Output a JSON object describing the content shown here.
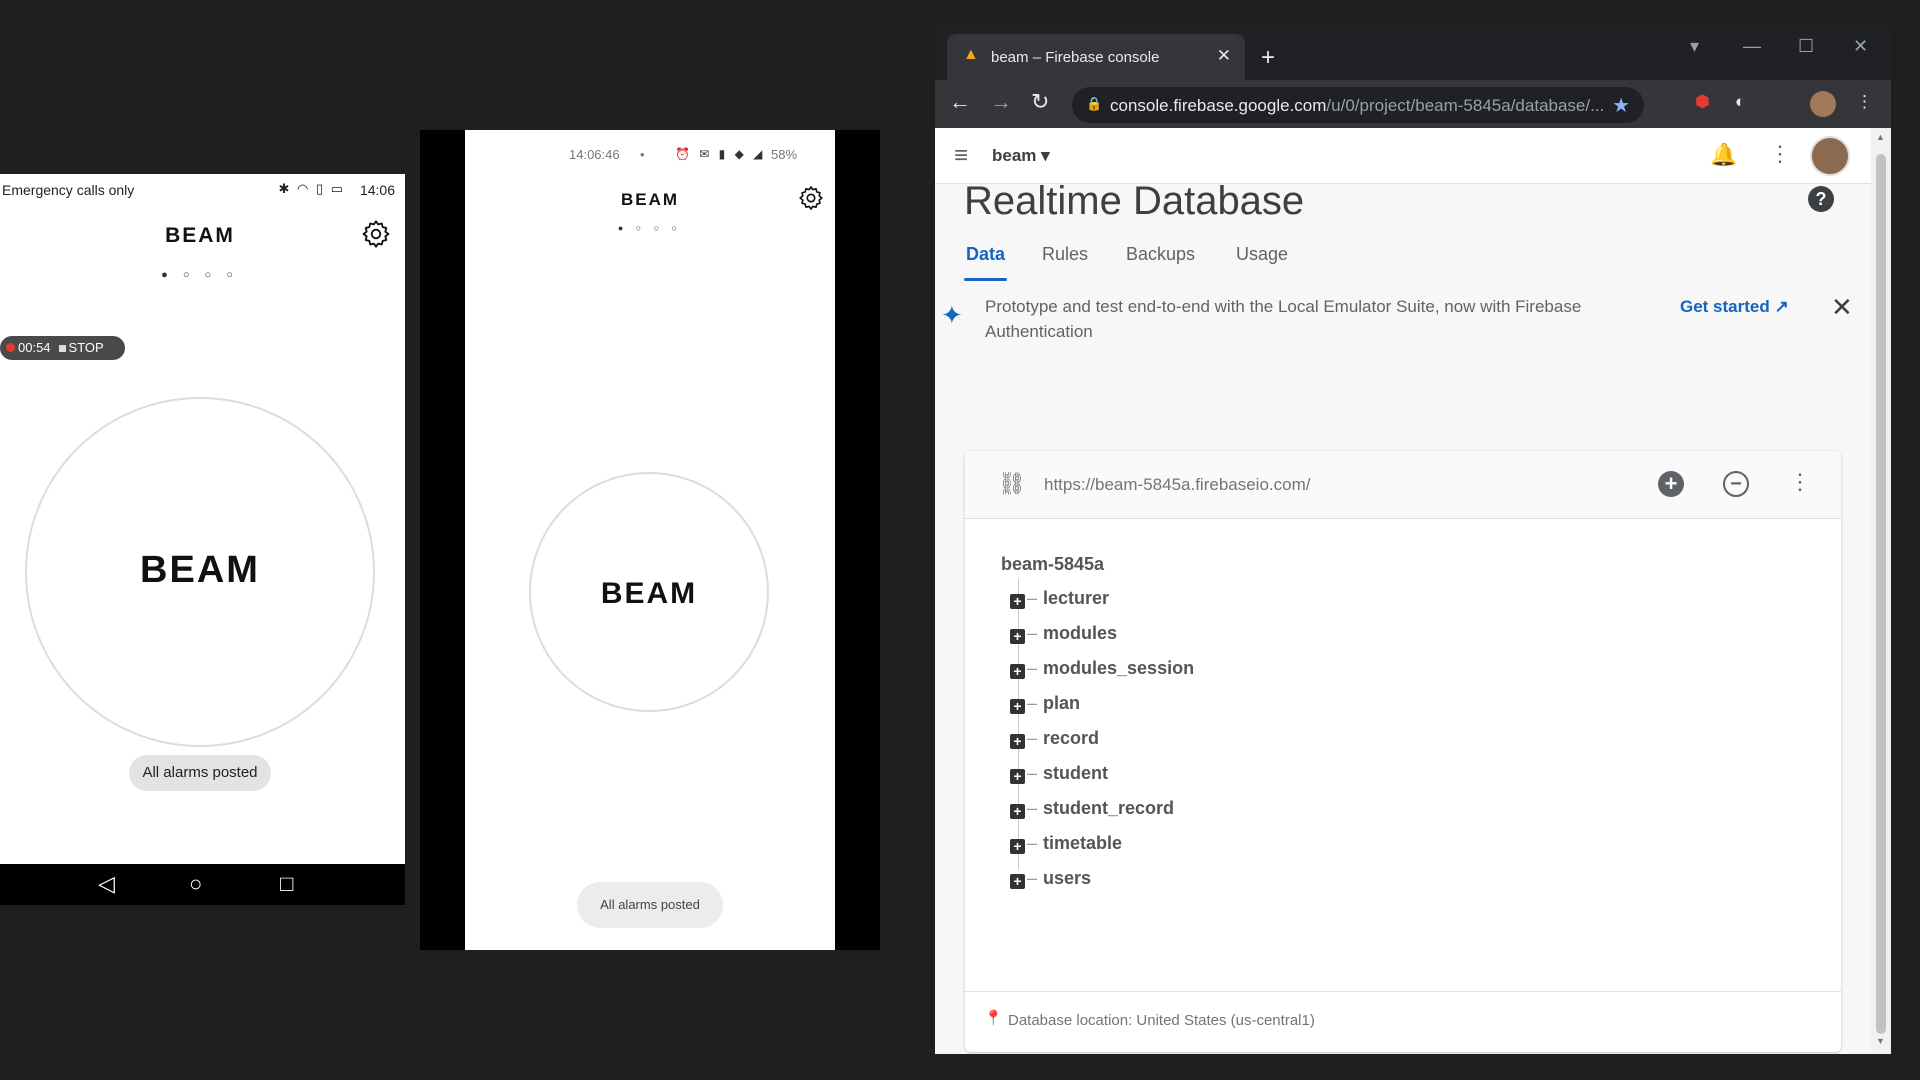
{
  "phone1": {
    "carrier": "Emergency calls only",
    "status_icons": "✱ ◠ ▯ ▭",
    "time": "14:06",
    "app_title": "BEAM",
    "page_dots": "● ○ ○ ○",
    "recording": {
      "time": "00:54",
      "stop_label": "STOP"
    },
    "circle_label": "BEAM",
    "toast": "All alarms posted",
    "nav": {
      "back": "◁",
      "home": "○",
      "recents": "□"
    }
  },
  "phone2": {
    "time": "14:06:46",
    "dot": "•",
    "status_icons": "⏰ ✉ ▮ ◆ ◢",
    "battery": "58%",
    "app_title": "BEAM",
    "page_dots": "● ○ ○ ○",
    "circle_label": "BEAM",
    "toast": "All alarms posted"
  },
  "browser": {
    "tab_title": "beam – Firebase console",
    "url_main": "console.firebase.google.com",
    "url_rest": "/u/0/project/beam-5845a/database/...",
    "header": {
      "project": "beam"
    },
    "page_title": "Realtime Database",
    "help": "?",
    "tabs": [
      "Data",
      "Rules",
      "Backups",
      "Usage"
    ],
    "banner": {
      "message": "Prototype and test end-to-end with the Local Emulator Suite, now with Firebase Authentication",
      "cta": "Get started ↗"
    },
    "db": {
      "url": "https://beam-5845a.firebaseio.com/",
      "root": "beam-5845a",
      "nodes": [
        "lecturer",
        "modules",
        "modules_session",
        "plan",
        "record",
        "student",
        "student_record",
        "timetable",
        "users"
      ],
      "location": "Database location: United States (us-central1)"
    }
  }
}
